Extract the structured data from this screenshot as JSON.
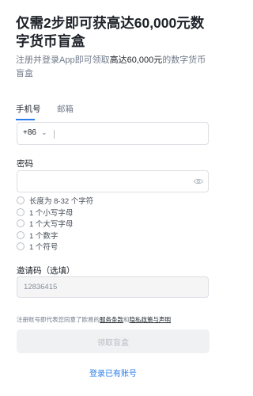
{
  "page": {
    "title": "仅需2步即可获高达60,000元数字货币盲盒",
    "subtitle_pre": "注册并登录App即可领取",
    "subtitle_hl": "高达60,000元",
    "subtitle_post": "的数字货币盲盒"
  },
  "tabs": [
    {
      "label": "手机号",
      "active": true
    },
    {
      "label": "邮箱",
      "active": false
    }
  ],
  "phone": {
    "country_code": "+86",
    "value": ""
  },
  "password": {
    "label": "密码",
    "value": "",
    "rules": [
      "长度为 8-32 个字符",
      "1 个小写字母",
      "1 个大写字母",
      "1 个数字",
      "1 个符号"
    ]
  },
  "referral": {
    "label": "邀请码（选填）",
    "value": "12836415"
  },
  "terms": {
    "pre": "注册账号即代表您同意了欧易的",
    "link1": "服务条款",
    "mid": "和",
    "link2": "隐私政策与声明"
  },
  "submit_label": "领取盲盒",
  "login_link": "登录已有账号",
  "colors": {
    "accent": "#2b7de9",
    "text": "#1e2329",
    "muted": "#707a8a"
  }
}
